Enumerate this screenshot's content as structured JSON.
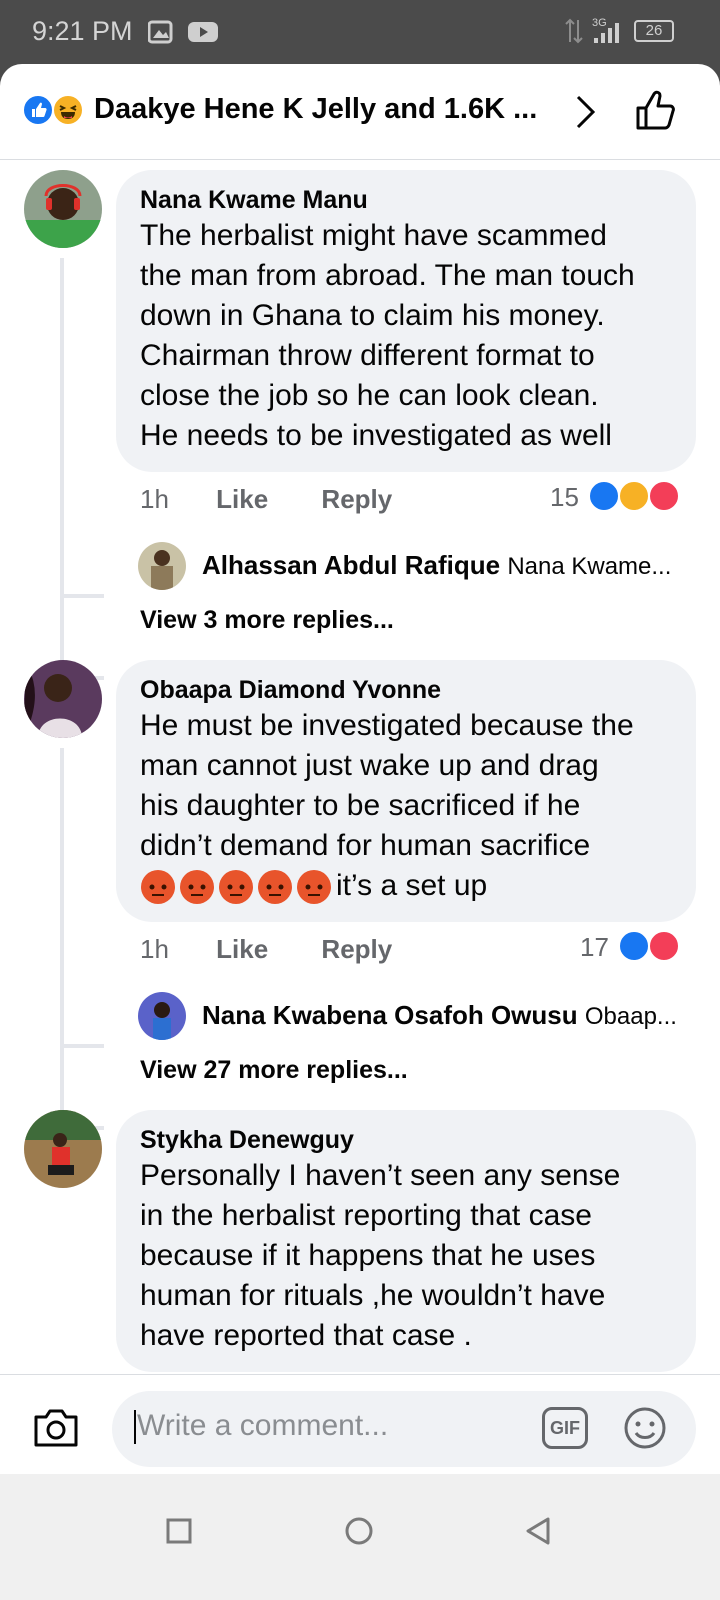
{
  "status": {
    "time": "9:21 PM",
    "network": "3G",
    "battery": "26"
  },
  "header": {
    "title": "Daakye Hene K Jelly and 1.6K ..."
  },
  "comments": [
    {
      "author": "Nana Kwame Manu",
      "lines": [
        "The herbalist might have scammed",
        "the man from abroad. The man touch",
        "down in Ghana to claim his money.",
        "Chairman throw different format to",
        "close the job so he can look clean.",
        "He needs to be investigated as well"
      ],
      "time": "1h",
      "like": "Like",
      "reply": "Reply",
      "count": "15",
      "reply_author": "Alhassan Abdul Rafique",
      "reply_preview": "Nana Kwame...",
      "more_replies": "View 3 more replies..."
    },
    {
      "author": "Obaapa Diamond Yvonne",
      "lines": [
        "He must be investigated because the",
        "man cannot just wake up and drag",
        "his daughter to be sacrificed if he",
        "didn’t demand for human sacrifice"
      ],
      "last_line_text": "it’s a set up",
      "time": "1h",
      "like": "Like",
      "reply": "Reply",
      "count": "17",
      "reply_author": "Nana Kwabena Osafoh Owusu",
      "reply_preview": "Obaap...",
      "more_replies": "View 27 more replies..."
    },
    {
      "author": "Stykha Denewguy",
      "lines": [
        "Personally  I haven’t seen any sense",
        "in the herbalist reporting that case",
        "because if it happens that he uses",
        "human for rituals ,he wouldn’t have",
        "have reported that case ."
      ]
    }
  ],
  "composer": {
    "placeholder": "Write a comment...",
    "gif_label": "GIF"
  },
  "colors": {
    "like_blue": "#1877f2",
    "love_red": "#f33e58",
    "haha_yellow": "#f7b125",
    "bubble_bg": "#f0f2f5"
  }
}
